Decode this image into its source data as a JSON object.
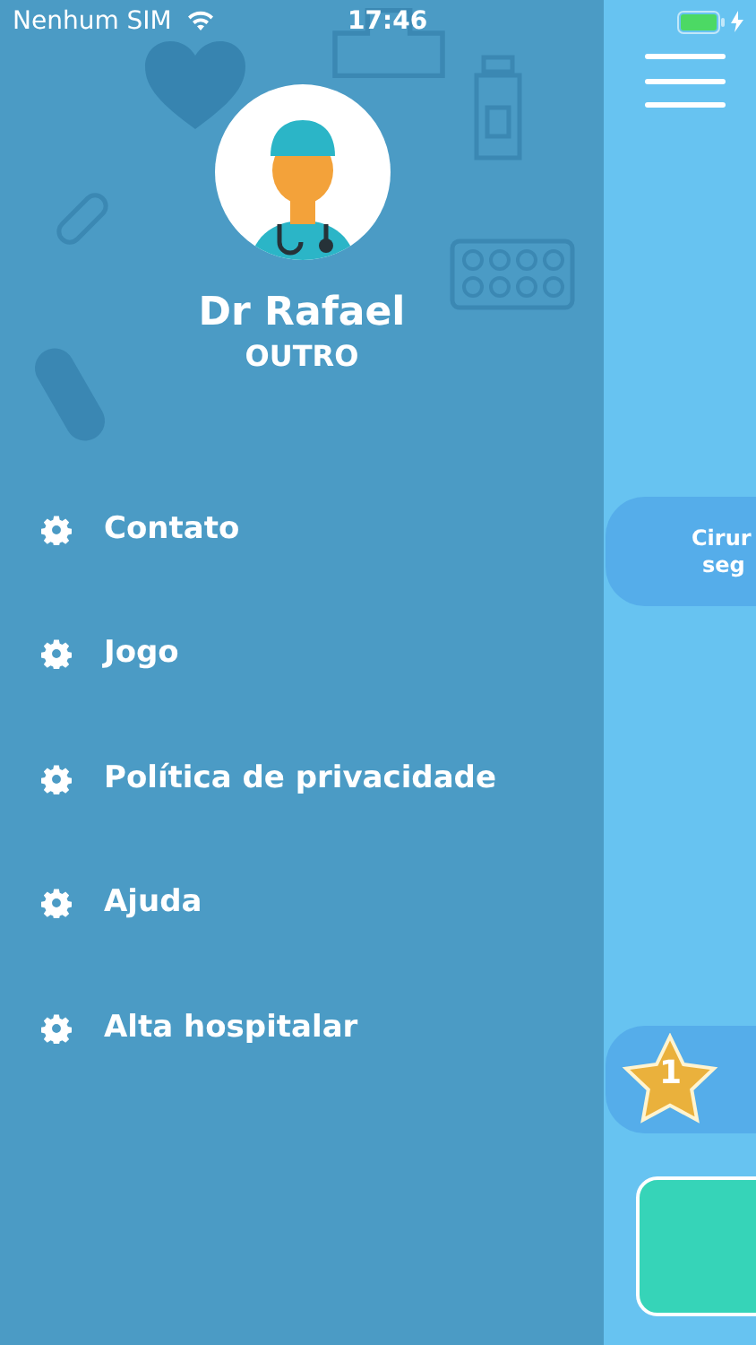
{
  "status_bar": {
    "carrier": "Nenhum SIM",
    "time": "17:46"
  },
  "profile": {
    "name": "Dr Rafael",
    "role": "OUTRO"
  },
  "menu": [
    {
      "label": "Contato"
    },
    {
      "label": "Jogo"
    },
    {
      "label": "Política de privacidade"
    },
    {
      "label": "Ajuda"
    },
    {
      "label": "Alta hospitalar"
    }
  ],
  "main": {
    "card_lines": [
      "Cirur",
      "seg"
    ],
    "star_badge": "1"
  }
}
